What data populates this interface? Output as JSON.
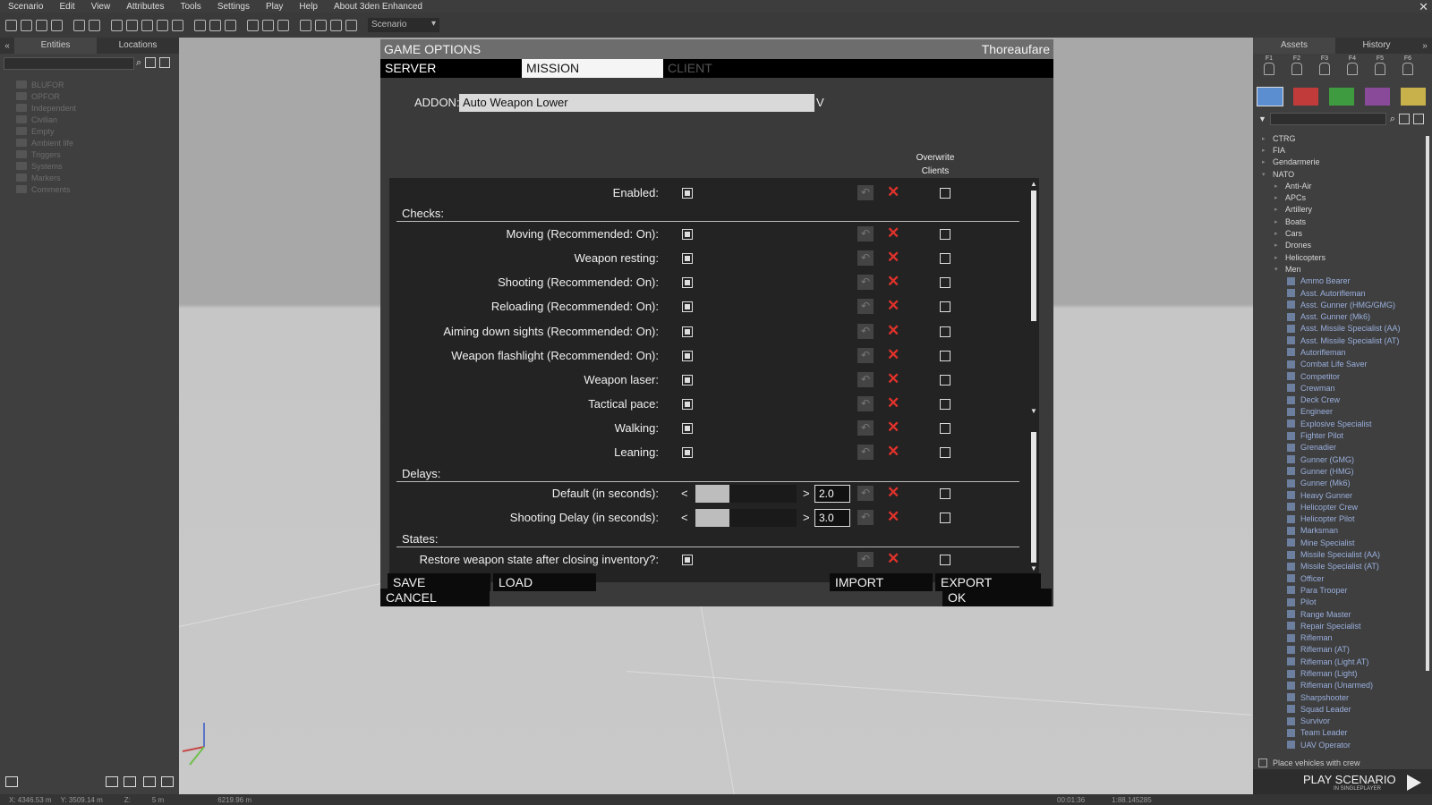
{
  "menubar": {
    "items": [
      "Scenario",
      "Edit",
      "View",
      "Attributes",
      "Tools",
      "Settings",
      "Play",
      "Help",
      "About 3den Enhanced"
    ]
  },
  "toolbar": {
    "scenario_select": "Scenario"
  },
  "left_panel": {
    "tabs": [
      "Entities",
      "Locations"
    ],
    "tree": [
      "BLUFOR",
      "OPFOR",
      "Independent",
      "Civilian",
      "Empty",
      "Ambient life",
      "Triggers",
      "Systems",
      "Markers",
      "Comments"
    ]
  },
  "statusbar": {
    "x": "X: 4346.53 m",
    "y": "Y: 3509.14 m",
    "z": "Z:",
    "grid": "5 m",
    "dist": "6219.96 m",
    "time": "00:01:36",
    "fps": "1:88.145285"
  },
  "right_panel": {
    "tabs": [
      "Assets",
      "History"
    ],
    "side_keys": [
      "F1",
      "F2",
      "F3",
      "F4",
      "F5",
      "F6"
    ],
    "faction_colors": [
      "#5b8ed0",
      "#c23b3b",
      "#3f9b3f",
      "#8a4a9a",
      "#c8b04a"
    ],
    "tree_top": [
      {
        "label": "CTRG",
        "expanded": false
      },
      {
        "label": "FIA",
        "expanded": false
      },
      {
        "label": "Gendarmerie",
        "expanded": false
      },
      {
        "label": "NATO",
        "expanded": true
      }
    ],
    "nato_groups": [
      "Anti-Air",
      "APCs",
      "Artillery",
      "Boats",
      "Cars",
      "Drones",
      "Helicopters",
      "Men"
    ],
    "men_units": [
      "Ammo Bearer",
      "Asst. Autorifleman",
      "Asst. Gunner (HMG/GMG)",
      "Asst. Gunner (Mk6)",
      "Asst. Missile Specialist (AA)",
      "Asst. Missile Specialist (AT)",
      "Autorifleman",
      "Combat Life Saver",
      "Competitor",
      "Crewman",
      "Deck Crew",
      "Engineer",
      "Explosive Specialist",
      "Fighter Pilot",
      "Grenadier",
      "Gunner (GMG)",
      "Gunner (HMG)",
      "Gunner (Mk6)",
      "Heavy Gunner",
      "Helicopter Crew",
      "Helicopter Pilot",
      "Marksman",
      "Mine Specialist",
      "Missile Specialist (AA)",
      "Missile Specialist (AT)",
      "Officer",
      "Para Trooper",
      "Pilot",
      "Range Master",
      "Repair Specialist",
      "Rifleman",
      "Rifleman (AT)",
      "Rifleman (Light AT)",
      "Rifleman (Light)",
      "Rifleman (Unarmed)",
      "Sharpshooter",
      "Squad Leader",
      "Survivor",
      "Team Leader",
      "UAV Operator"
    ],
    "place_vehicles": "Place vehicles with crew",
    "play_label": "PLAY SCENARIO",
    "play_sub": "IN SINGLEPLAYER"
  },
  "dialog": {
    "title": "GAME OPTIONS",
    "user": "Thoreaufare",
    "tabs": [
      {
        "label": "SERVER",
        "state": "normal"
      },
      {
        "label": "MISSION",
        "state": "active"
      },
      {
        "label": "CLIENT",
        "state": "disabled"
      }
    ],
    "addon_label": "ADDON:",
    "addon_value": "Auto Weapon Lower",
    "addon_caret": "V",
    "overwrite_header": "Overwrite Clients",
    "options": [
      {
        "kind": "checkbox",
        "label": "Enabled:",
        "checked": true,
        "overwrite": false
      },
      {
        "kind": "section",
        "label": "Checks:"
      },
      {
        "kind": "checkbox",
        "label": "Moving (Recommended: On):",
        "checked": true,
        "overwrite": false
      },
      {
        "kind": "checkbox",
        "label": "Weapon resting:",
        "checked": true,
        "overwrite": false
      },
      {
        "kind": "checkbox",
        "label": "Shooting (Recommended: On):",
        "checked": true,
        "overwrite": false
      },
      {
        "kind": "checkbox",
        "label": "Reloading (Recommended: On):",
        "checked": true,
        "overwrite": false
      },
      {
        "kind": "checkbox",
        "label": "Aiming down sights (Recommended: On):",
        "checked": true,
        "overwrite": false
      },
      {
        "kind": "checkbox",
        "label": "Weapon flashlight (Recommended: On):",
        "checked": true,
        "overwrite": false
      },
      {
        "kind": "checkbox",
        "label": "Weapon laser:",
        "checked": true,
        "overwrite": false
      },
      {
        "kind": "checkbox",
        "label": "Tactical pace:",
        "checked": true,
        "overwrite": false
      },
      {
        "kind": "checkbox",
        "label": "Walking:",
        "checked": true,
        "overwrite": false
      },
      {
        "kind": "checkbox",
        "label": "Leaning:",
        "checked": true,
        "overwrite": false
      },
      {
        "kind": "section",
        "label": "Delays:"
      },
      {
        "kind": "slider",
        "label": "Default (in seconds):",
        "value": "2.0",
        "fraction": 0.0,
        "overwrite": false
      },
      {
        "kind": "slider",
        "label": "Shooting Delay (in seconds):",
        "value": "3.0",
        "fraction": 0.0,
        "overwrite": false
      },
      {
        "kind": "section",
        "label": "States:"
      },
      {
        "kind": "checkbox",
        "label": "Restore weapon state after closing inventory?:",
        "checked": true,
        "overwrite": false
      }
    ],
    "slider_left": "<",
    "slider_right": ">",
    "buttons": {
      "save": "SAVE",
      "load": "LOAD",
      "import": "IMPORT",
      "export": "EXPORT",
      "cancel": "CANCEL",
      "ok": "OK"
    }
  },
  "icons": {
    "reset": "undo-arrow-icon",
    "delete": "red-x-icon",
    "search": "search-icon"
  }
}
